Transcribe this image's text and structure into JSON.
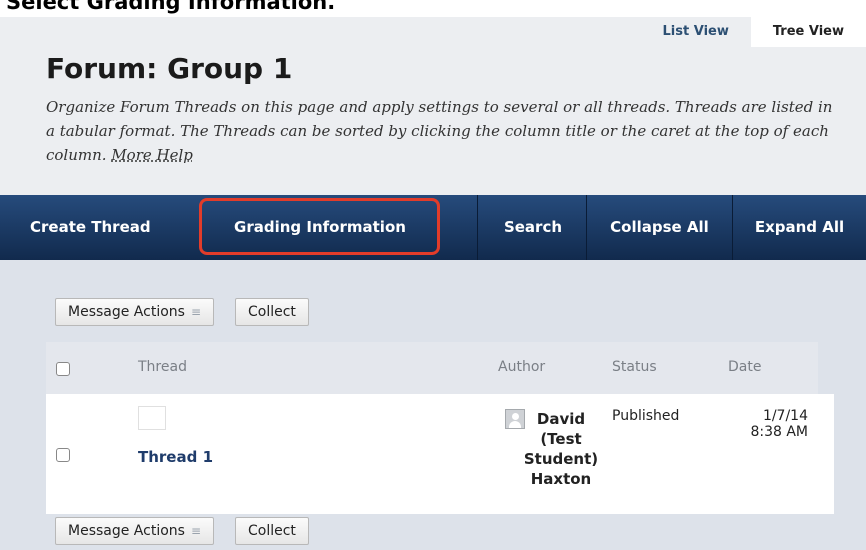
{
  "caption": "Select Grading Information.",
  "view_tabs": {
    "list": "List View",
    "tree": "Tree View"
  },
  "page": {
    "title": "Forum: Group 1",
    "description": "Organize Forum Threads on this page and apply settings to several or all threads. Threads are listed in a tabular format. The Threads can be sorted by clicking the column title or the caret at the top of each column.",
    "more_help": "More Help"
  },
  "toolbar": {
    "create_thread": "Create Thread",
    "grading_information": "Grading Information",
    "search": "Search",
    "collapse_all": "Collapse All",
    "expand_all": "Expand All",
    "highlight_color": "#e23c2a"
  },
  "actions": {
    "message_actions": "Message Actions",
    "collect": "Collect"
  },
  "table": {
    "headers": {
      "thread": "Thread",
      "author": "Author",
      "status": "Status",
      "date": "Date"
    },
    "rows": [
      {
        "thread": "Thread 1",
        "author": "David (Test Student) Haxton",
        "status": "Published",
        "date_line1": "1/7/14",
        "date_line2": "8:38 AM"
      }
    ]
  }
}
